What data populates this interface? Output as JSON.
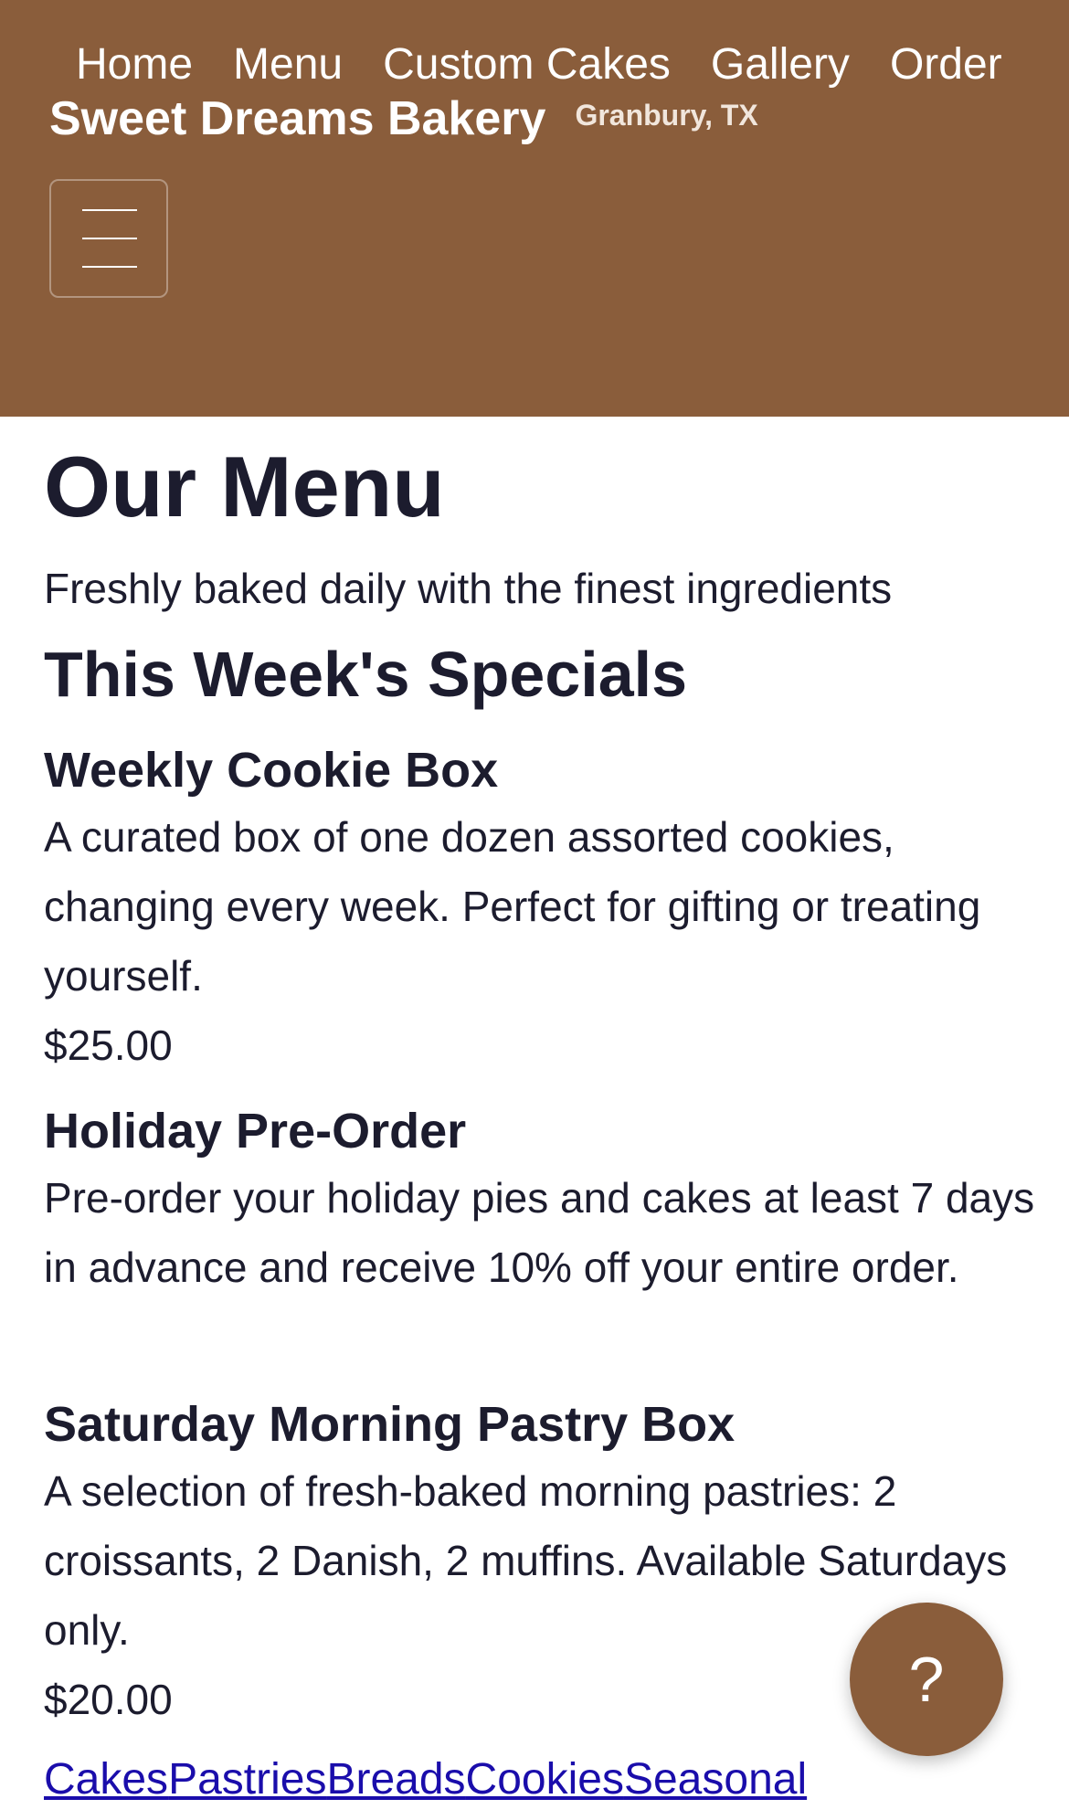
{
  "header": {
    "nav": [
      "Home",
      "Menu",
      "Custom Cakes",
      "Gallery",
      "Order"
    ],
    "brand_name": "Sweet Dreams Bakery",
    "location": "Granbury, TX",
    "menu_toggle_icon": "hamburger-icon"
  },
  "main": {
    "title": "Our Menu",
    "subtitle": "Freshly baked daily with the finest ingredients",
    "specials_title": "This Week's Specials",
    "specials": [
      {
        "name": "Weekly Cookie Box",
        "description": "A curated box of one dozen assorted cookies, changing every week. Perfect for gifting or treating yourself.",
        "price": "$25.00"
      },
      {
        "name": "Holiday Pre-Order",
        "description": "Pre-order your holiday pies and cakes at least 7 days in advance and receive 10% off your entire order.",
        "price": ""
      },
      {
        "name": "Saturday Morning Pastry Box",
        "description": "A selection of fresh-baked morning pastries: 2 croissants, 2 Danish, 2 muffins. Available Saturdays only.",
        "price": "$20.00"
      }
    ],
    "categories": [
      "Cakes",
      "Pastries",
      "Breads",
      "Cookies",
      "Seasonal"
    ]
  },
  "help_button": {
    "label": "?",
    "icon": "help-icon"
  },
  "colors": {
    "header_bg": "#8a5d3b",
    "text": "#1c1c2e",
    "link": "#1a0dab"
  }
}
